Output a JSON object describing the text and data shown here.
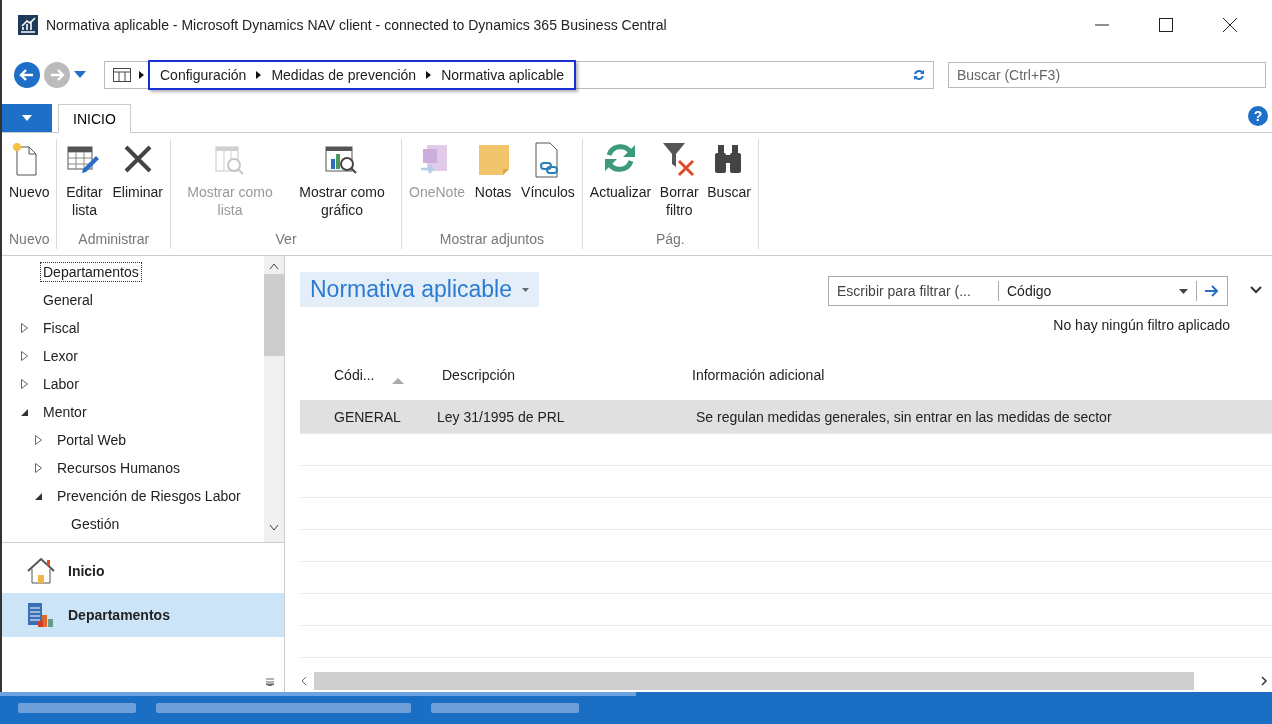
{
  "window": {
    "title": "Normativa aplicable - Microsoft Dynamics NAV client - connected to Dynamics 365 Business Central"
  },
  "address_bar": {
    "breadcrumb": [
      "Configuración",
      "Medidas de prevención",
      "Normativa aplicable"
    ],
    "highlighted": true
  },
  "search": {
    "placeholder": "Buscar (Ctrl+F3)"
  },
  "ribbon": {
    "tabs": [
      {
        "label": "INICIO",
        "selected": true
      }
    ],
    "help": "?",
    "groups": [
      {
        "label": "Nuevo",
        "buttons": [
          {
            "label": "Nuevo",
            "kind": "new",
            "disabled": false
          }
        ]
      },
      {
        "label": "Administrar",
        "buttons": [
          {
            "label": "Editar lista",
            "kind": "edit",
            "disabled": false
          },
          {
            "label": "Eliminar",
            "kind": "delete",
            "disabled": false
          }
        ]
      },
      {
        "label": "Ver",
        "buttons": [
          {
            "label": "Mostrar como lista",
            "kind": "list",
            "disabled": true
          },
          {
            "label": "Mostrar como gráfico",
            "kind": "chart",
            "disabled": false
          }
        ]
      },
      {
        "label": "Mostrar adjuntos",
        "buttons": [
          {
            "label": "OneNote",
            "kind": "onenote",
            "disabled": true
          },
          {
            "label": "Notas",
            "kind": "notes",
            "disabled": false
          },
          {
            "label": "Vínculos",
            "kind": "links",
            "disabled": false
          }
        ]
      },
      {
        "label": "Pág.",
        "buttons": [
          {
            "label": "Actualizar",
            "kind": "refresh",
            "disabled": false
          },
          {
            "label": "Borrar filtro",
            "kind": "clearfilter",
            "disabled": false
          },
          {
            "label": "Buscar",
            "kind": "find",
            "disabled": false
          }
        ]
      }
    ]
  },
  "sidebar": {
    "tree": [
      {
        "label": "Departamentos",
        "kind": "leaf",
        "selected": true
      },
      {
        "label": "General",
        "kind": "leaf",
        "selected": false
      },
      {
        "label": "Fiscal",
        "kind": "folder",
        "expanded": false,
        "selected": false
      },
      {
        "label": "Lexor",
        "kind": "folder",
        "expanded": false,
        "selected": false
      },
      {
        "label": "Labor",
        "kind": "folder",
        "expanded": false,
        "selected": false
      },
      {
        "label": "Mentor",
        "kind": "folder",
        "expanded": true,
        "selected": false,
        "children": [
          {
            "label": "Portal Web",
            "kind": "folder",
            "expanded": false,
            "selected": false
          },
          {
            "label": "Recursos Humanos",
            "kind": "folder",
            "expanded": false,
            "selected": false
          },
          {
            "label": "Prevención de Riesgos Labor",
            "kind": "folder",
            "expanded": true,
            "selected": false,
            "children": [
              {
                "label": "Gestión",
                "kind": "leaf",
                "selected": false
              }
            ]
          }
        ]
      }
    ],
    "nav_buttons": [
      {
        "label": "Inicio",
        "kind": "home",
        "selected": false
      },
      {
        "label": "Departamentos",
        "kind": "departments",
        "selected": true
      }
    ]
  },
  "list": {
    "title": "Normativa aplicable",
    "filter": {
      "placeholder": "Escribir para filtrar (...",
      "field": "Código"
    },
    "filter_status": "No hay ningún filtro aplicado",
    "columns": [
      {
        "label": "Códi...",
        "sorted": true
      },
      {
        "label": "Descripción",
        "sorted": false
      },
      {
        "label": "Información adicional",
        "sorted": false
      }
    ],
    "rows": [
      {
        "cells": [
          "GENERAL",
          "Ley 31/1995 de PRL",
          "Se regulan medidas generales, sin entrar en las medidas de sector"
        ],
        "selected": true
      }
    ]
  },
  "status_bar": {
    "progress": {
      "level": 0.5
    }
  }
}
